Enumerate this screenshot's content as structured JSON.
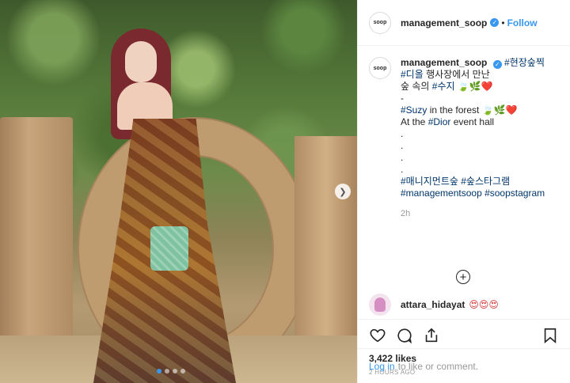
{
  "post": {
    "account": {
      "avatar_text": "soop",
      "username": "management_soop",
      "verified": true,
      "separator": "•",
      "follow_label": "Follow"
    },
    "caption": {
      "username": "management_soop",
      "lines": [
        "#현장숲찍",
        "#디올 행사장에서 만난",
        "숲 속의 #수지 🍃🌿❤️",
        "-",
        "#Suzy in the forest 🍃🌿❤️",
        "At the #Dior event hall",
        ".",
        ".",
        ".",
        ".",
        "#매니지먼트숲 #숲스타그램",
        "#managementsoop #soopstagram"
      ],
      "time": "2h"
    },
    "comments": [
      {
        "username": "attara_hidayat",
        "text": "😍😍😍"
      }
    ],
    "likes": "3,422 likes",
    "posted_ago": "2 HOURS AGO",
    "login": {
      "link": "Log in",
      "rest": "to like or comment."
    },
    "carousel": {
      "current": 1,
      "total": 4
    }
  },
  "icons": {
    "next": "chevron-right-icon",
    "more_comments": "plus-circle-icon",
    "like": "heart-icon",
    "comment": "comment-icon",
    "share": "share-icon",
    "save": "bookmark-icon"
  },
  "colors": {
    "accent": "#3897f0",
    "hashtag": "#003569",
    "muted": "#999999",
    "border": "#efefef"
  }
}
